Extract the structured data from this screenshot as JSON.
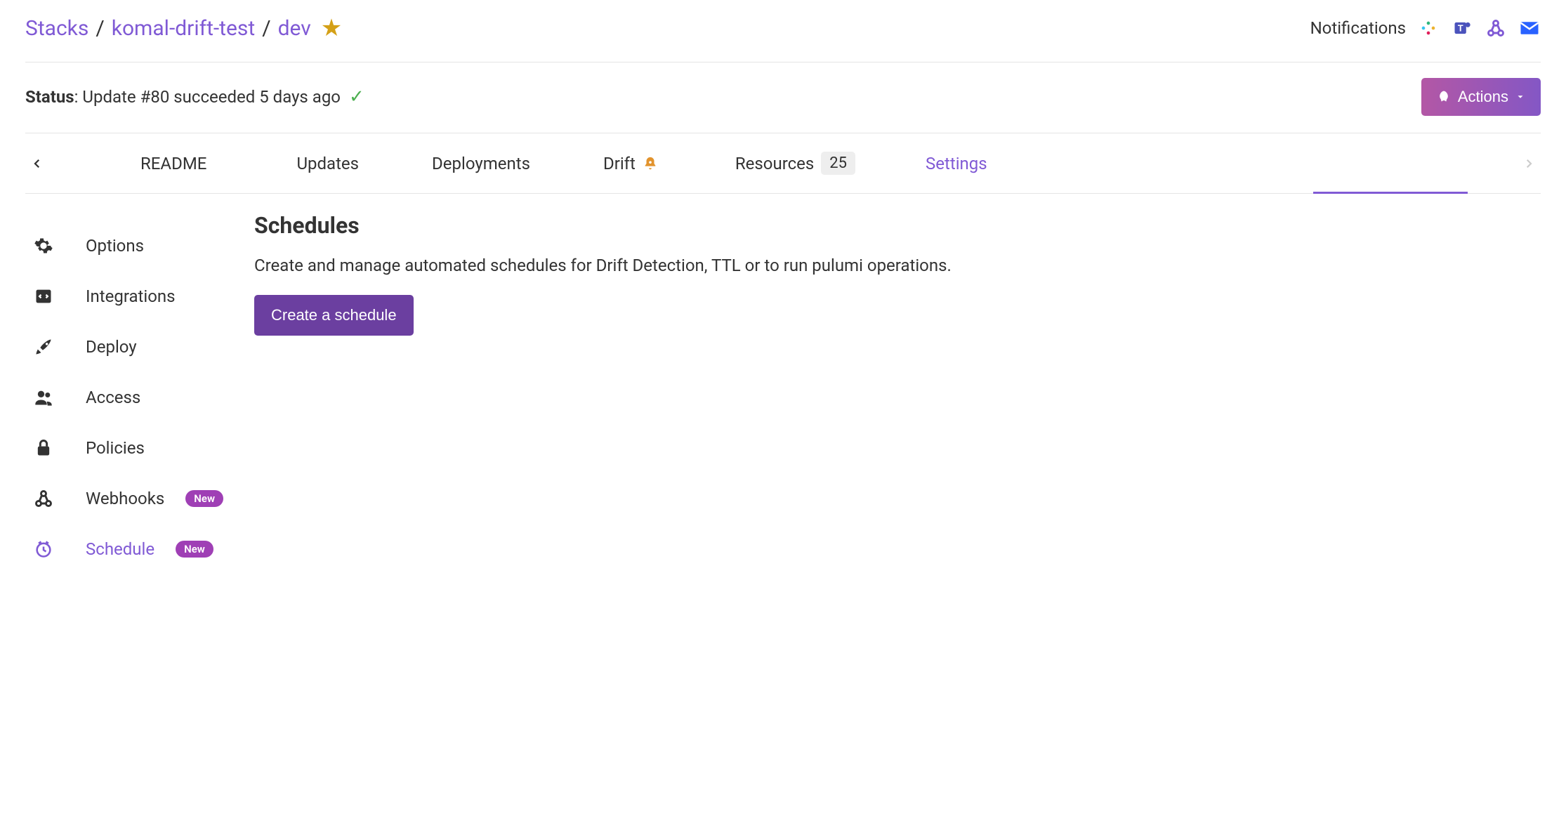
{
  "breadcrumb": {
    "root": "Stacks",
    "project": "komal-drift-test",
    "stack": "dev"
  },
  "header": {
    "notifications_label": "Notifications"
  },
  "status": {
    "label": "Status",
    "text": ": Update #80 succeeded 5 days ago"
  },
  "actions": {
    "label": "Actions"
  },
  "tabs": {
    "readme": "README",
    "updates": "Updates",
    "deployments": "Deployments",
    "drift": "Drift",
    "resources": "Resources",
    "resources_count": "25",
    "settings": "Settings"
  },
  "sidebar": {
    "options": "Options",
    "integrations": "Integrations",
    "deploy": "Deploy",
    "access": "Access",
    "policies": "Policies",
    "webhooks": "Webhooks",
    "schedule": "Schedule",
    "new_badge": "New"
  },
  "main": {
    "title": "Schedules",
    "description": "Create and manage automated schedules for Drift Detection, TTL or to run pulumi operations.",
    "create_button": "Create a schedule"
  }
}
